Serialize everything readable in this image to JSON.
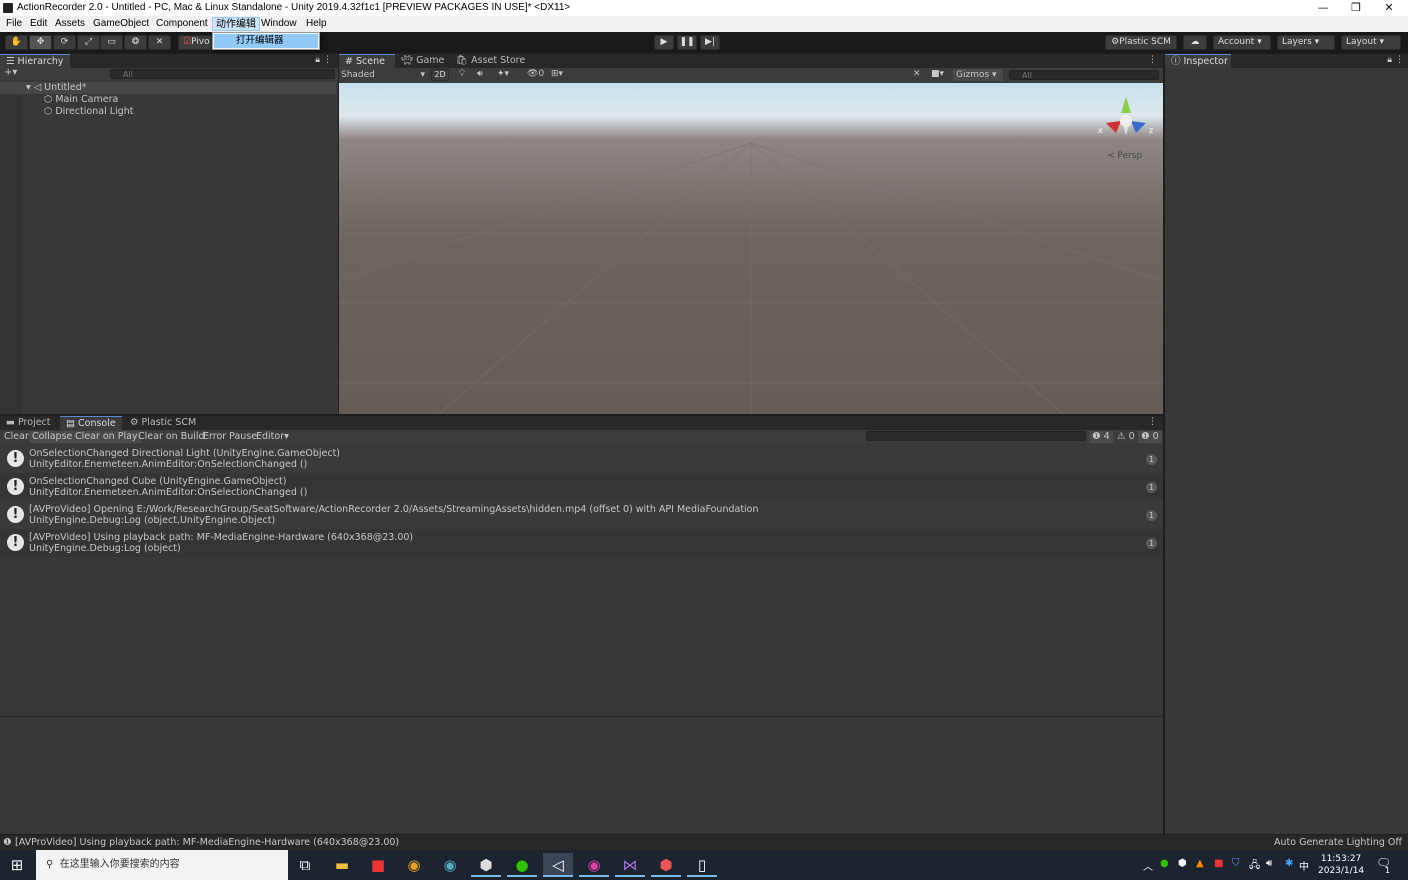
{
  "window": {
    "title": "ActionRecorder 2.0 - Untitled - PC, Mac & Linux Standalone - Unity 2019.4.32f1c1 [PREVIEW PACKAGES IN USE]* <DX11>",
    "minimize": "—",
    "restore": "❐",
    "close": "✕"
  },
  "menubar": {
    "items": [
      "File",
      "Edit",
      "Assets",
      "GameObject",
      "Component",
      "动作编辑",
      "Window",
      "Help"
    ],
    "active_index": 5
  },
  "dropdown": {
    "items": [
      "打开编辑器"
    ]
  },
  "toolbar": {
    "pivot_label": "Pivo",
    "plastic_label": "Plastic SCM",
    "account_label": "Account",
    "layers_label": "Layers",
    "layout_label": "Layout"
  },
  "hierarchy": {
    "tab": "Hierarchy",
    "add_label": "+▾",
    "search_placeholder": "All",
    "scene": "Untitled*",
    "items": [
      "Main Camera",
      "Directional Light"
    ]
  },
  "scene": {
    "tabs": [
      "Scene",
      "Game",
      "Asset Store"
    ],
    "shading": "Shaded",
    "mode_2d": "2D",
    "fx_count": "0",
    "gizmos": "Gizmos",
    "search_placeholder": "All",
    "persp_label": "Persp",
    "axis_x": "x",
    "axis_z": "z"
  },
  "inspector": {
    "tab": "Inspector"
  },
  "console": {
    "tabs": [
      "Project",
      "Console",
      "Plastic SCM"
    ],
    "buttons": [
      "Clear",
      "Collapse",
      "Clear on Play",
      "Clear on Build",
      "Error Pause",
      "Editor"
    ],
    "counts": {
      "info": "4",
      "warn": "0",
      "error": "0"
    },
    "messages": [
      {
        "line1": "OnSelectionChanged  Directional Light (UnityEngine.GameObject)",
        "line2": "UnityEditor.Enemeteen.AnimEditor:OnSelectionChanged ()",
        "count": "1"
      },
      {
        "line1": "OnSelectionChanged  Cube (UnityEngine.GameObject)",
        "line2": "UnityEditor.Enemeteen.AnimEditor:OnSelectionChanged ()",
        "count": "1"
      },
      {
        "line1": "[AVProVideo] Opening E:/Work/ResearchGroup/SeatSoftware/ActionRecorder 2.0/Assets/StreamingAssets\\hidden.mp4 (offset 0) with API MediaFoundation",
        "line2": "UnityEngine.Debug:Log (object,UnityEngine.Object)",
        "count": "1"
      },
      {
        "line1": "[AVProVideo] Using playback path: MF-MediaEngine-Hardware (640x368@23.00)",
        "line2": "UnityEngine.Debug:Log (object)",
        "count": "1"
      }
    ]
  },
  "statusbar": {
    "message": "[AVProVideo] Using playback path: MF-MediaEngine-Hardware (640x368@23.00)",
    "right": "Auto Generate Lighting Off"
  },
  "taskbar": {
    "search_placeholder": "在这里输入你要搜索的内容",
    "time": "11:53:27",
    "date": "2023/1/14",
    "ime": "中",
    "notif_count": "1"
  }
}
